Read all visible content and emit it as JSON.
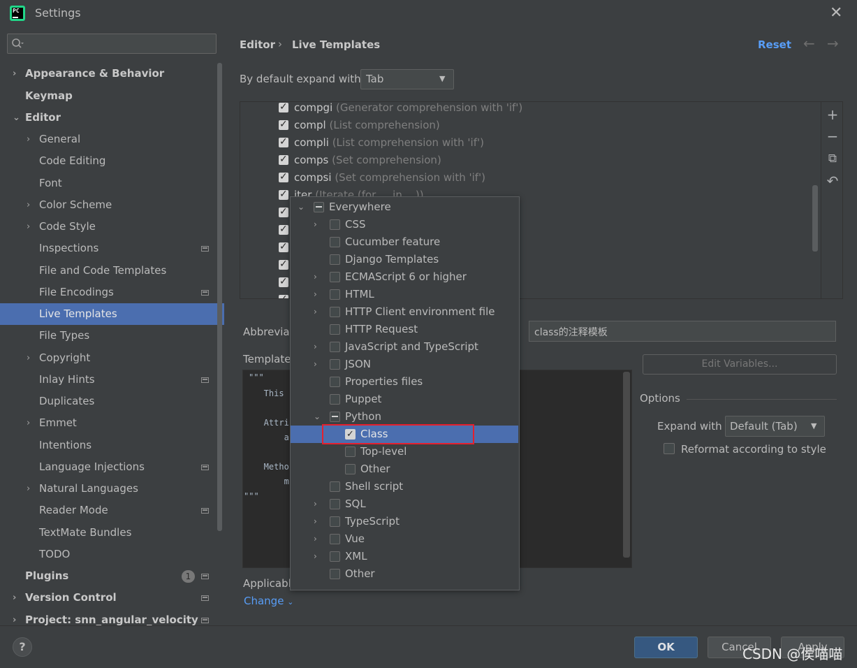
{
  "window": {
    "title": "Settings",
    "close": "✕"
  },
  "search": {
    "placeholder": "",
    "value": ""
  },
  "sidebar": {
    "items": [
      {
        "label": "Appearance & Behavior",
        "bold": true,
        "arrow": "›"
      },
      {
        "label": "Keymap",
        "bold": true
      },
      {
        "label": "Editor",
        "bold": true,
        "arrow": "⌄"
      },
      {
        "label": "General",
        "arrow": "›"
      },
      {
        "label": "Code Editing"
      },
      {
        "label": "Font"
      },
      {
        "label": "Color Scheme",
        "arrow": "›"
      },
      {
        "label": "Code Style",
        "arrow": "›"
      },
      {
        "label": "Inspections"
      },
      {
        "label": "File and Code Templates"
      },
      {
        "label": "File Encodings"
      },
      {
        "label": "Live Templates",
        "selected": true
      },
      {
        "label": "File Types"
      },
      {
        "label": "Copyright",
        "arrow": "›"
      },
      {
        "label": "Inlay Hints"
      },
      {
        "label": "Duplicates"
      },
      {
        "label": "Emmet",
        "arrow": "›"
      },
      {
        "label": "Intentions"
      },
      {
        "label": "Language Injections"
      },
      {
        "label": "Natural Languages",
        "arrow": "›"
      },
      {
        "label": "Reader Mode"
      },
      {
        "label": "TextMate Bundles"
      },
      {
        "label": "TODO"
      },
      {
        "label": "Plugins",
        "bold": true,
        "badge": "1"
      },
      {
        "label": "Version Control",
        "bold": true,
        "arrow": "›"
      },
      {
        "label": "Project: snn_angular_velocity",
        "bold": true,
        "arrow": "›"
      }
    ]
  },
  "header": {
    "breadcrumb_root": "Editor",
    "breadcrumb_sep": "›",
    "breadcrumb_current": "Live Templates",
    "reset": "Reset",
    "back": "←",
    "forward": "→"
  },
  "expand": {
    "label": "By default expand with",
    "value": "Tab"
  },
  "templates": [
    {
      "name": "compgi",
      "desc": "(Generator comprehension with 'if')"
    },
    {
      "name": "compl",
      "desc": "(List comprehension)"
    },
    {
      "name": "compli",
      "desc": "(List comprehension with 'if')"
    },
    {
      "name": "comps",
      "desc": "(Set comprehension)"
    },
    {
      "name": "compsi",
      "desc": "(Set comprehension with 'if')"
    },
    {
      "name": "iter",
      "desc": "(Iterate (for ... in ...))"
    }
  ],
  "toolbar": {
    "add": "+",
    "remove": "−",
    "copy": "⧉",
    "restore": "↶"
  },
  "abbreviation": {
    "label": "Abbrevia"
  },
  "description": {
    "value": "class的注释模板"
  },
  "template_text": {
    "label": "Template",
    "lines": [
      "\"\"\"",
      "   This",
      "",
      "   Attri",
      "       a",
      "",
      "   Metho",
      "       m",
      "\"\"\""
    ]
  },
  "edit_variables": "Edit Variables...",
  "options": {
    "title": "Options",
    "expand_with_label": "Expand with",
    "expand_with_value": "Default (Tab)",
    "reformat_label": "Reformat according to style"
  },
  "applicable": {
    "label": "Applicabl",
    "change": "Change"
  },
  "context_popup": {
    "rows": [
      {
        "label": "Everywhere",
        "state": "mixed",
        "arrow": "⌄",
        "level": 0
      },
      {
        "label": "CSS",
        "state": "unchecked",
        "arrow": "›",
        "level": 1
      },
      {
        "label": "Cucumber feature",
        "state": "unchecked",
        "level": 1
      },
      {
        "label": "Django Templates",
        "state": "unchecked",
        "level": 1
      },
      {
        "label": "ECMAScript 6 or higher",
        "state": "unchecked",
        "arrow": "›",
        "level": 1
      },
      {
        "label": "HTML",
        "state": "unchecked",
        "arrow": "›",
        "level": 1
      },
      {
        "label": "HTTP Client environment file",
        "state": "unchecked",
        "arrow": "›",
        "level": 1
      },
      {
        "label": "HTTP Request",
        "state": "unchecked",
        "level": 1
      },
      {
        "label": "JavaScript and TypeScript",
        "state": "unchecked",
        "arrow": "›",
        "level": 1
      },
      {
        "label": "JSON",
        "state": "unchecked",
        "arrow": "›",
        "level": 1
      },
      {
        "label": "Properties files",
        "state": "unchecked",
        "level": 1
      },
      {
        "label": "Puppet",
        "state": "unchecked",
        "level": 1
      },
      {
        "label": "Python",
        "state": "mixed",
        "arrow": "⌄",
        "level": 1
      },
      {
        "label": "Class",
        "state": "checked",
        "level": 2,
        "selected": true
      },
      {
        "label": "Top-level",
        "state": "unchecked",
        "level": 2
      },
      {
        "label": "Other",
        "state": "unchecked",
        "level": 2
      },
      {
        "label": "Shell script",
        "state": "unchecked",
        "level": 1
      },
      {
        "label": "SQL",
        "state": "unchecked",
        "arrow": "›",
        "level": 1
      },
      {
        "label": "TypeScript",
        "state": "unchecked",
        "arrow": "›",
        "level": 1
      },
      {
        "label": "Vue",
        "state": "unchecked",
        "arrow": "›",
        "level": 1
      },
      {
        "label": "XML",
        "state": "unchecked",
        "arrow": "›",
        "level": 1
      },
      {
        "label": "Other",
        "state": "unchecked",
        "level": 1
      }
    ]
  },
  "buttons": {
    "help": "?",
    "ok": "OK",
    "cancel": "Cancel",
    "apply": "Apply"
  },
  "watermark": "CSDN @侯喵喵",
  "colors": {
    "accent": "#4b6eaf",
    "link": "#589df6",
    "highlight_box": "#e5202e"
  }
}
